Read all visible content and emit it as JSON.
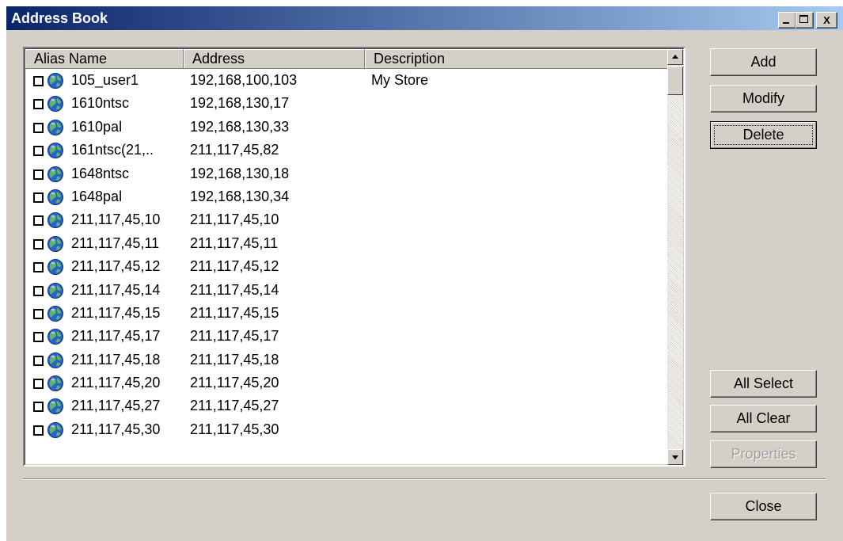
{
  "window": {
    "title": "Address Book",
    "minimize_label": "_",
    "maximize_label": "□",
    "close_label": "X"
  },
  "list": {
    "columns": [
      "Alias Name",
      "Address",
      "Description"
    ],
    "rows": [
      {
        "alias": "105_user1",
        "address": "192,168,100,103",
        "description": "My Store"
      },
      {
        "alias": "1610ntsc",
        "address": "192,168,130,17",
        "description": ""
      },
      {
        "alias": "1610pal",
        "address": "192,168,130,33",
        "description": ""
      },
      {
        "alias": "161ntsc(21,..",
        "address": "211,117,45,82",
        "description": ""
      },
      {
        "alias": "1648ntsc",
        "address": "192,168,130,18",
        "description": ""
      },
      {
        "alias": "1648pal",
        "address": "192,168,130,34",
        "description": ""
      },
      {
        "alias": "211,117,45,10",
        "address": "211,117,45,10",
        "description": ""
      },
      {
        "alias": "211,117,45,11",
        "address": "211,117,45,11",
        "description": ""
      },
      {
        "alias": "211,117,45,12",
        "address": "211,117,45,12",
        "description": ""
      },
      {
        "alias": "211,117,45,14",
        "address": "211,117,45,14",
        "description": ""
      },
      {
        "alias": "211,117,45,15",
        "address": "211,117,45,15",
        "description": ""
      },
      {
        "alias": "211,117,45,17",
        "address": "211,117,45,17",
        "description": ""
      },
      {
        "alias": "211,117,45,18",
        "address": "211,117,45,18",
        "description": ""
      },
      {
        "alias": "211,117,45,20",
        "address": "211,117,45,20",
        "description": ""
      },
      {
        "alias": "211,117,45,27",
        "address": "211,117,45,27",
        "description": ""
      },
      {
        "alias": "211,117,45,30",
        "address": "211,117,45,30",
        "description": ""
      }
    ]
  },
  "buttons": {
    "add": "Add",
    "modify": "Modify",
    "delete": "Delete",
    "all_select": "All Select",
    "all_clear": "All Clear",
    "properties": "Properties",
    "close": "Close"
  },
  "colors": {
    "title_start": "#0a246a",
    "title_end": "#a6caf0",
    "face": "#d4d0c8"
  },
  "icons": {
    "row_icon": "globe-icon"
  }
}
